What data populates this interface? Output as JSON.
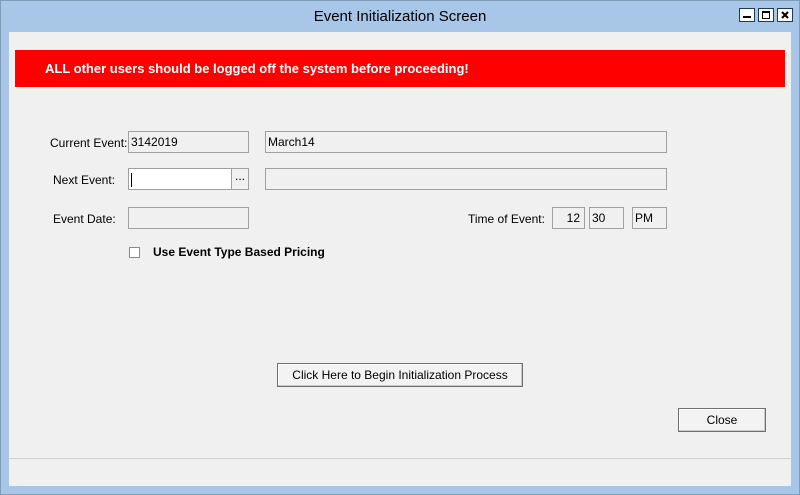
{
  "window": {
    "title": "Event Initialization Screen",
    "controls": [
      "minimize-icon",
      "maximize-icon",
      "close-icon"
    ]
  },
  "warning": {
    "text": "ALL other users should be logged off the system before proceeding!",
    "color": "#ff0000"
  },
  "current_event": {
    "label": "Current Event:",
    "code": "3142019",
    "name": "March14"
  },
  "next_event": {
    "label": "Next Event:",
    "code": "",
    "browse_label": "...",
    "name": ""
  },
  "event_date": {
    "label": "Event Date:",
    "value": ""
  },
  "time_of_event": {
    "label": "Time of Event:",
    "hour": "12",
    "minute": "30",
    "ampm": "PM"
  },
  "pricing": {
    "label": "Use Event Type Based Pricing",
    "checked": false
  },
  "buttons": {
    "begin": "Click Here to Begin Initialization Process",
    "close": "Close"
  }
}
